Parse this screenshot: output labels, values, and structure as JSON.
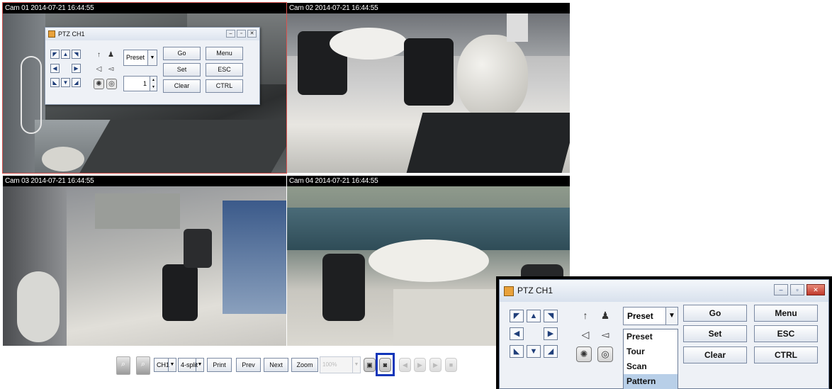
{
  "cameras": [
    {
      "label": "Cam 01 2014-07-21 16:44:55"
    },
    {
      "label": "Cam 02 2014-07-21 16:44:55"
    },
    {
      "label": "Cam 03 2014-07-21 16:44:55"
    },
    {
      "label": "Cam 04 2014-07-21 16:44:55"
    }
  ],
  "ptz_window": {
    "title": "PTZ CH1",
    "mode_select": "Preset",
    "preset_number": "1",
    "buttons": {
      "go": "Go",
      "menu": "Menu",
      "set": "Set",
      "esc": "ESC",
      "clear": "Clear",
      "ctrl": "CTRL"
    },
    "dropdown_options": [
      "Preset",
      "Tour",
      "Scan",
      "Pattern"
    ],
    "highlighted_option": "Pattern"
  },
  "toolbar": {
    "channel_select": "CH1",
    "split_select": "4-split",
    "print": "Print",
    "prev": "Prev",
    "next": "Next",
    "zoom": "Zoom",
    "zoom_level": "100%"
  },
  "icons": {
    "arrows": [
      "arrow-up-left",
      "arrow-up",
      "arrow-up-right",
      "arrow-left",
      "arrow-right",
      "arrow-down-left",
      "arrow-down",
      "arrow-down-right"
    ],
    "zoom": [
      "zoom-in-icon",
      "zoom-out-icon"
    ],
    "focus": [
      "focus-near-icon",
      "focus-far-icon"
    ],
    "iris": [
      "iris-open-icon",
      "iris-close-icon"
    ]
  },
  "colors": {
    "highlight_border": "#1035b9",
    "cam1_border": "#d9534f",
    "selected_option": "#b8cfe8"
  }
}
